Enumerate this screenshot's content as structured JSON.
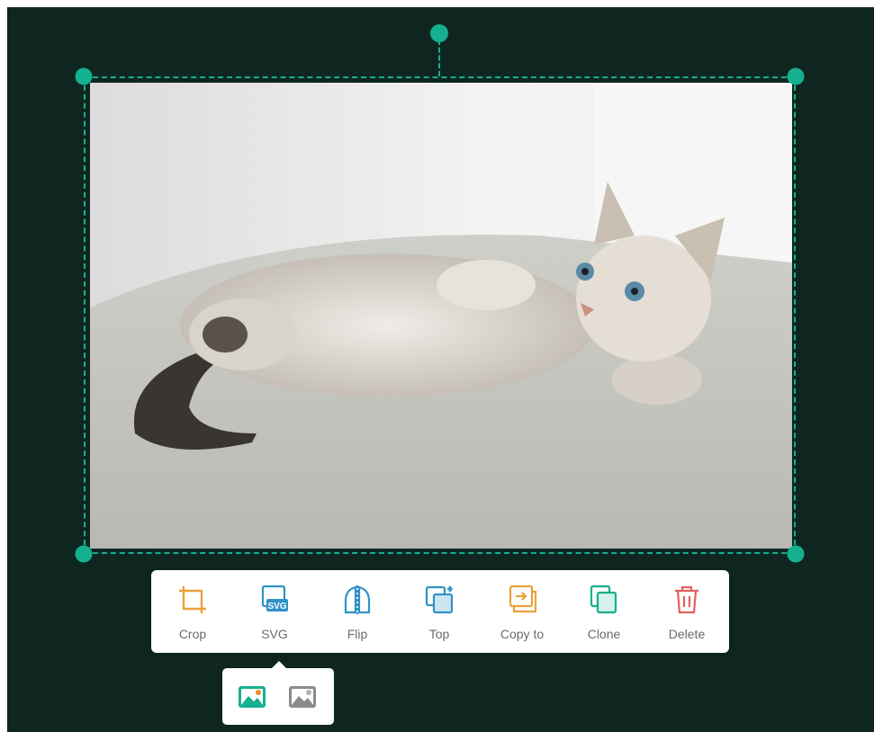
{
  "toolbar": {
    "items": [
      {
        "label": "Crop",
        "icon": "crop-icon",
        "color": "#e8a23a"
      },
      {
        "label": "SVG",
        "icon": "svg-icon",
        "color": "#2f93c6"
      },
      {
        "label": "Flip",
        "icon": "flip-icon",
        "color": "#2f93c6"
      },
      {
        "label": "Top",
        "icon": "bring-to-top-icon",
        "color": "#2f93c6"
      },
      {
        "label": "Copy to",
        "icon": "copy-to-icon",
        "color": "#e8a23a"
      },
      {
        "label": "Clone",
        "icon": "clone-icon",
        "color": "#14b08f"
      },
      {
        "label": "Delete",
        "icon": "trash-icon",
        "color": "#e26060"
      }
    ]
  },
  "svg_popover": {
    "options": [
      {
        "icon": "color-image-icon",
        "selected": true
      },
      {
        "icon": "grayscale-image-icon",
        "selected": false
      }
    ]
  },
  "colors": {
    "canvas_background": "#0f2620",
    "selection_accent": "#14b08f"
  },
  "image": {
    "subject": "kitten-photo"
  }
}
